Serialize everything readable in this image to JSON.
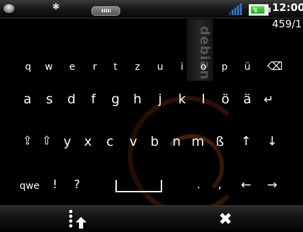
{
  "status_bar": {
    "time": "12:00",
    "icons": [
      "menu-disc-icon",
      "bluetooth-icon",
      "keyboard-indicator-icon",
      "signal-icon",
      "battery-charging-icon"
    ],
    "bluetooth_glyph": "✱",
    "battery_glyph": "↯"
  },
  "counter": "459/1",
  "watermark": "debian",
  "keyboard": {
    "row1": [
      "q",
      "w",
      "e",
      "r",
      "t",
      "z",
      "u",
      "i",
      "o",
      "p",
      "ü",
      "⌫"
    ],
    "row2": [
      "a",
      "s",
      "d",
      "f",
      "g",
      "h",
      "j",
      "k",
      "l",
      "ö",
      "ä",
      "↵"
    ],
    "row3": [
      "⇪",
      "⇧",
      "y",
      "x",
      "c",
      "v",
      "b",
      "n",
      "m",
      "ß",
      "↑",
      "↓"
    ],
    "row4": [
      "qwe",
      "!",
      "?",
      "space",
      ".",
      ",",
      "←",
      "→"
    ]
  },
  "bottom_bar": {
    "shift_icon": "more-options-arrow-icon",
    "close_glyph": "✖"
  }
}
